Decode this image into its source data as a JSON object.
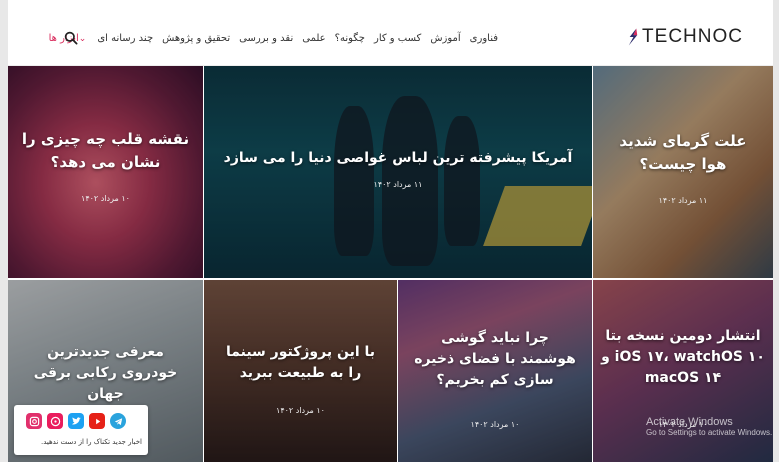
{
  "logo": {
    "text": "TECHNOC"
  },
  "nav": [
    "فناوری",
    "آموزش",
    "کسب و کار",
    "چگونه؟",
    "علمی",
    "نقد و بررسی",
    "تحقیق و پژوهش",
    "چند رسانه ای",
    "ابزار ها"
  ],
  "nav_active_index": 8,
  "accent_color": "#d92a5b",
  "search_icon": "search-icon",
  "cards": [
    {
      "title": "نقشه قلب چه چیزی را نشان می دهد؟",
      "date": "۱۰ مرداد ۱۴۰۲"
    },
    {
      "title": "آمریکا پیشرفته ترین لباس غواصی دنیا را می سازد",
      "date": "۱۱ مرداد ۱۴۰۲"
    },
    {
      "title": "علت گرمای شدید هوا چیست؟",
      "date": "۱۱ مرداد ۱۴۰۲"
    },
    {
      "title": "معرفی جدیدترین خودروی رکابی برقی جهان",
      "date": ""
    },
    {
      "title": "با این پروژکتور سینما را به طبیعت ببرید",
      "date": "۱۰ مرداد ۱۴۰۲"
    },
    {
      "title": "چرا نباید گوشی هوشمند با فضای ذخیره سازی کم بخریم؟",
      "date": "۱۰ مرداد ۱۴۰۲"
    },
    {
      "title": "انتشار دومین نسخه بتا iOS ۱۷، watchOS ۱۰ و macOS ۱۴",
      "date": "۱۰ مرداد ۱۴۰۲"
    }
  ],
  "social": {
    "text": "اخبار جدید تکناک را از دست ندهید.",
    "icons": [
      "telegram-icon",
      "twitter-icon",
      "youtube-icon",
      "aparat-icon",
      "instagram-icon"
    ]
  },
  "watermark": {
    "line1": "Activate Windows",
    "line2": "Go to Settings to activate Windows."
  }
}
